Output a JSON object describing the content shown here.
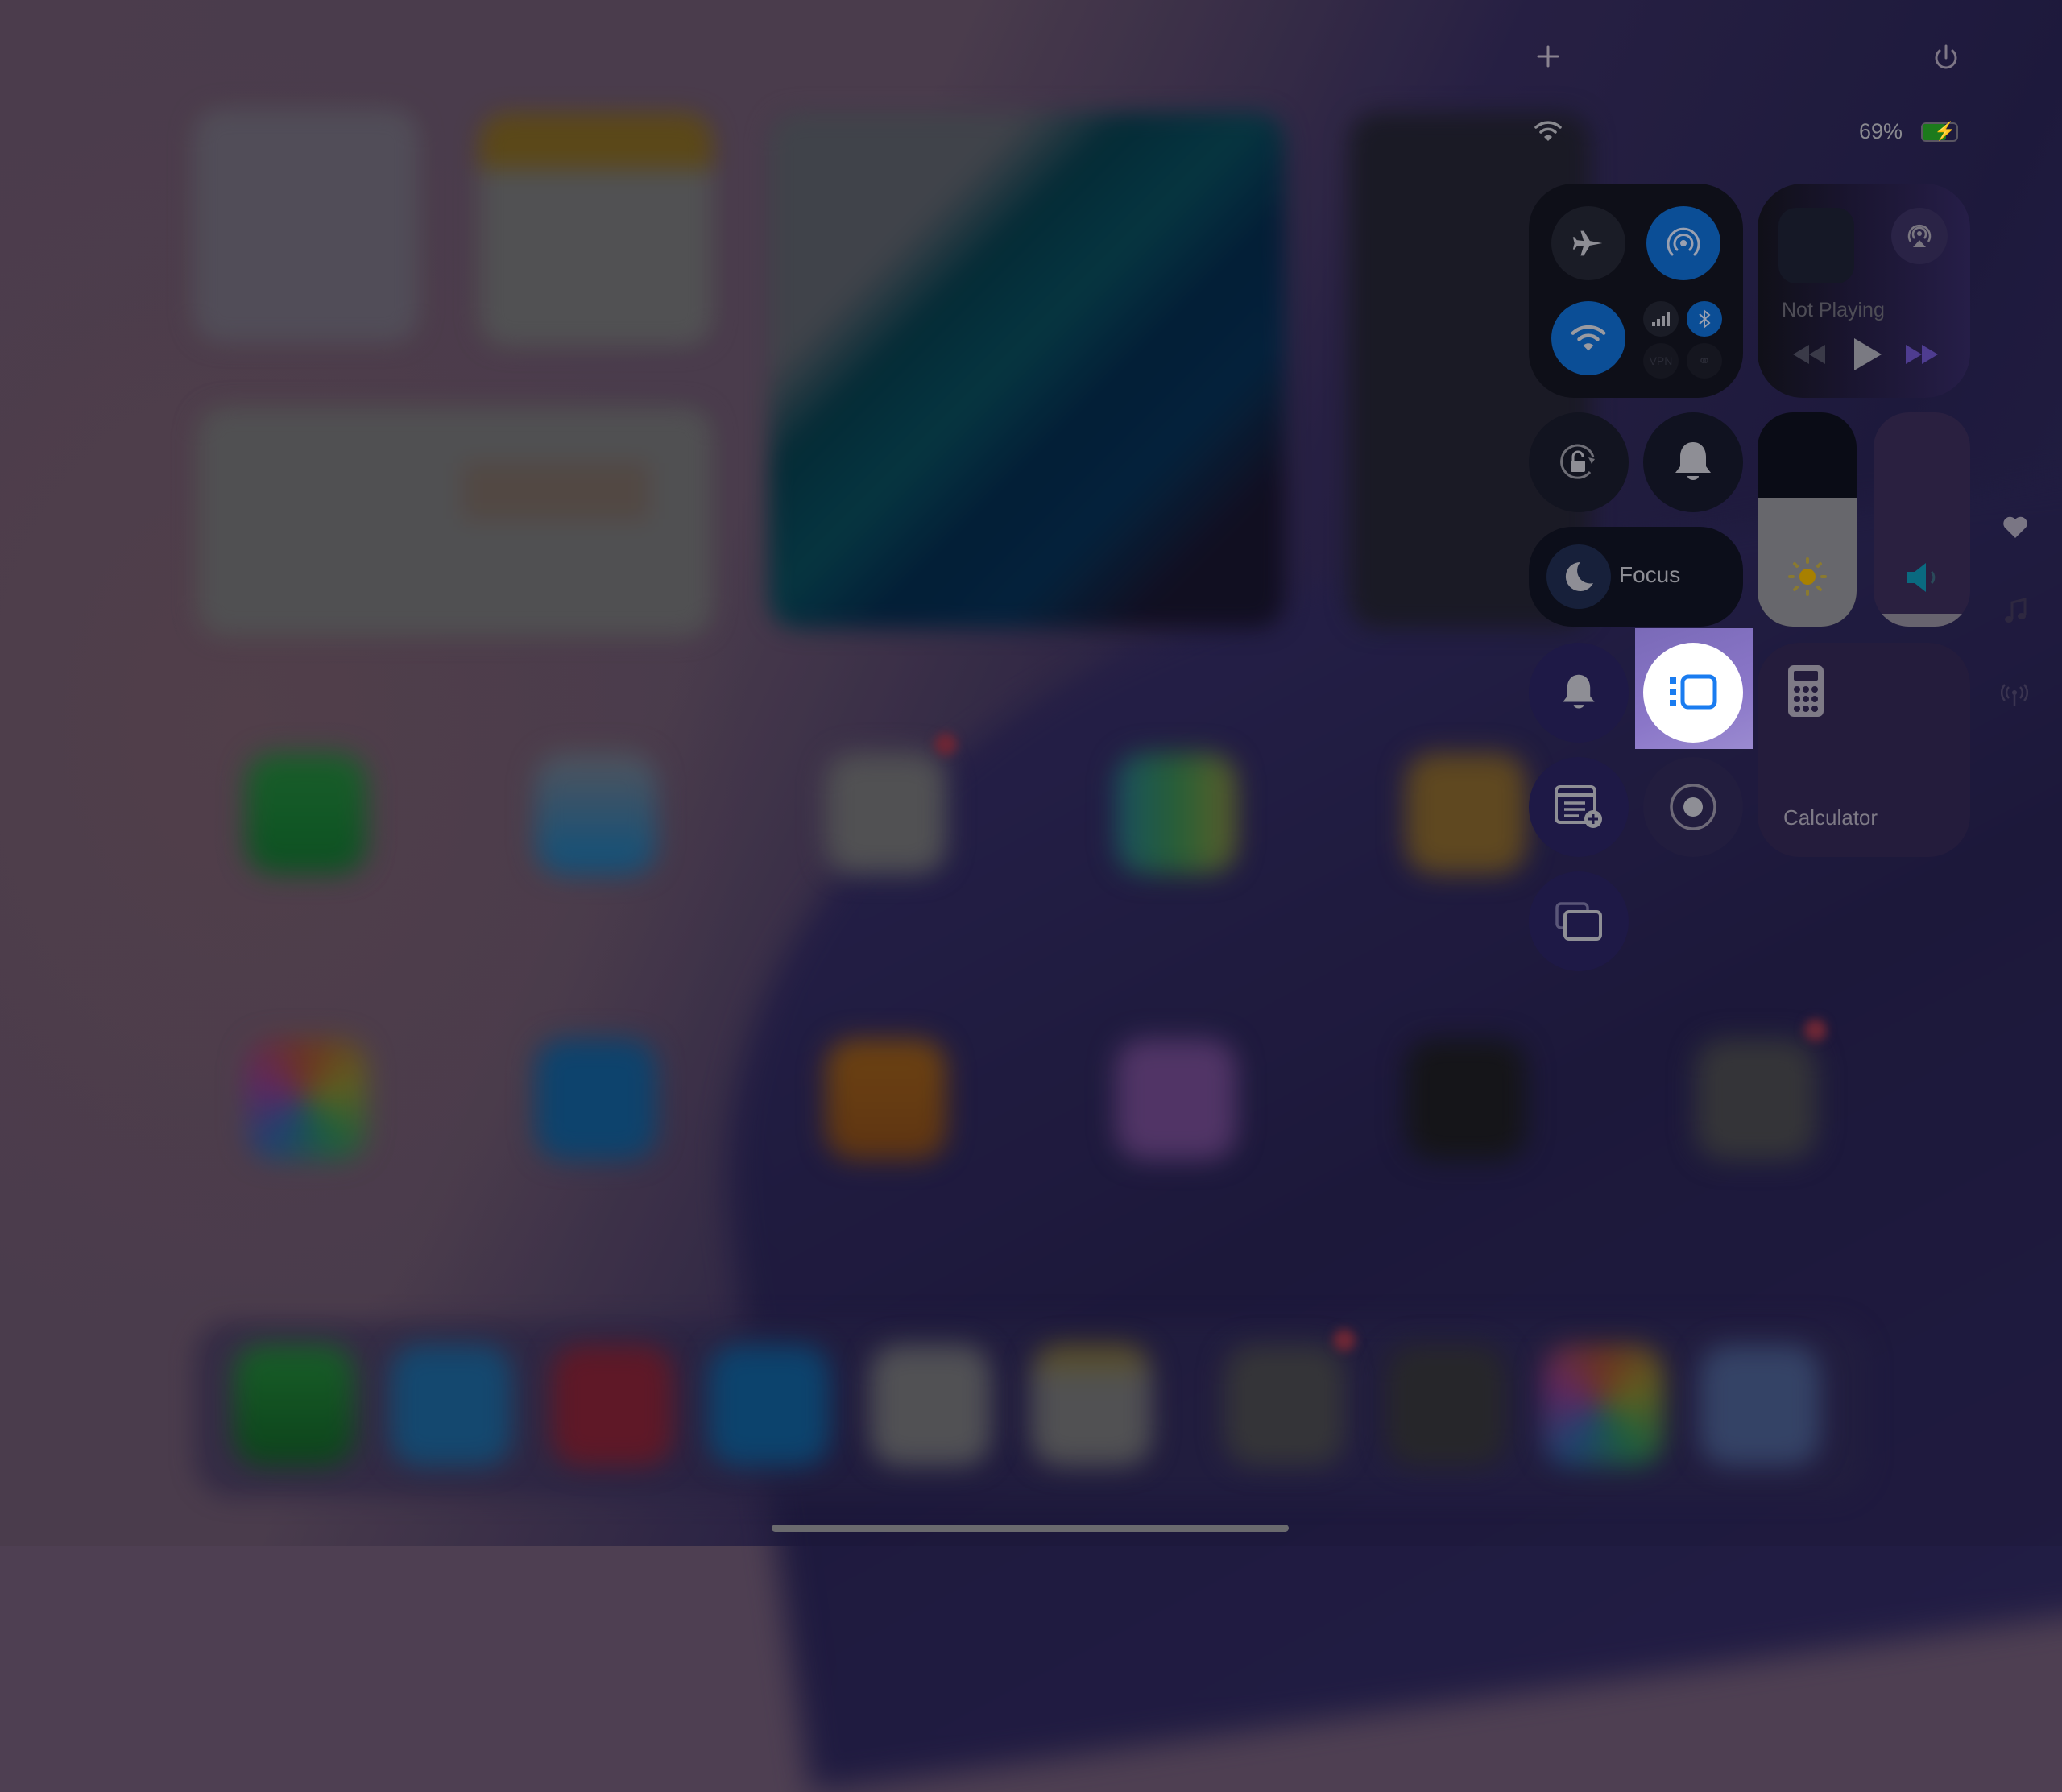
{
  "status_bar": {
    "add_icon": "plus-icon",
    "power_icon": "power-icon",
    "wifi_icon": "wifi-icon",
    "battery_percent": "69%",
    "battery_level": 0.69,
    "battery_charging": true
  },
  "connectivity": {
    "airplane_mode": {
      "icon": "airplane-icon",
      "on": false
    },
    "airdrop": {
      "icon": "airdrop-icon",
      "on": true
    },
    "wifi": {
      "icon": "wifi-icon",
      "on": true
    },
    "cellular": {
      "icon": "cellular-icon",
      "on": false
    },
    "bluetooth": {
      "icon": "bluetooth-icon",
      "on": true
    },
    "vpn": {
      "icon": "vpn-icon",
      "on": false
    },
    "hotspot": {
      "icon": "personal-hotspot-icon",
      "on": false
    }
  },
  "now_playing": {
    "status": "Not Playing",
    "airplay_icon": "airplay-icon",
    "rewind_icon": "rewind-icon",
    "play_icon": "play-icon",
    "forward_icon": "fast-forward-icon"
  },
  "controls": {
    "orientation_lock_icon": "orientation-lock-icon",
    "silent_mode_icon": "bell-icon",
    "focus_label": "Focus",
    "focus_icon": "moon-icon",
    "brightness": {
      "icon": "sun-icon",
      "level": 0.6
    },
    "volume": {
      "icon": "speaker-icon",
      "level": 0.06
    },
    "alarm_icon": "bell-icon",
    "stage_manager_icon": "stage-manager-icon",
    "quick_note_icon": "quick-note-icon",
    "screen_recording_icon": "screen-record-icon",
    "screen_mirroring_icon": "screen-mirroring-icon",
    "calculator_label": "Calculator",
    "calculator_icon": "calculator-icon"
  },
  "side_controls": {
    "heart_icon": "heart-icon",
    "music_icon": "music-note-icon",
    "connectivity_icon": "antenna-icon"
  },
  "colors": {
    "active_blue": "#0b4e96",
    "highlight": "#8a76c8",
    "stage_manager_blue": "#1a7cf0"
  }
}
